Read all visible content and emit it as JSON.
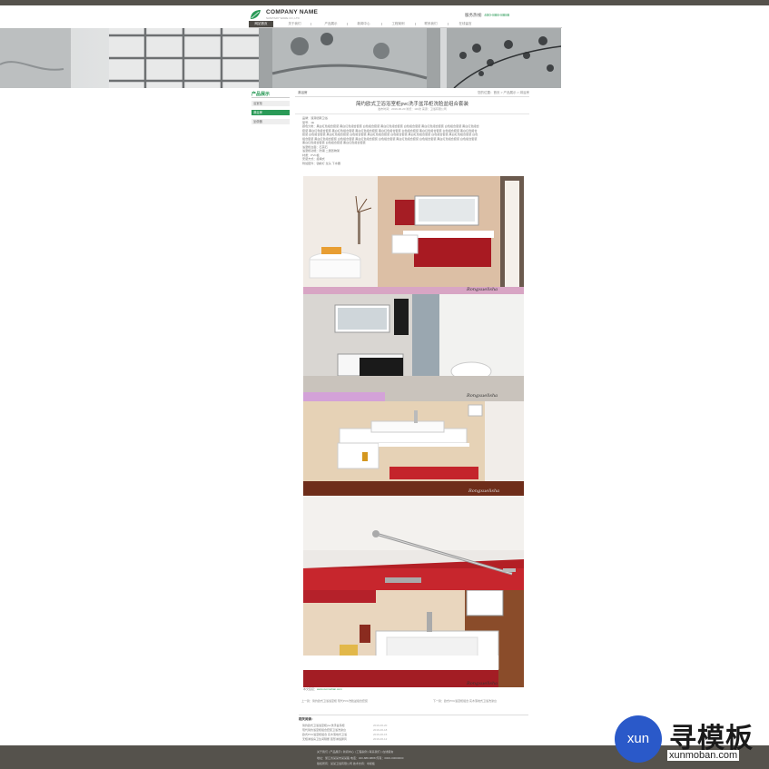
{
  "header": {
    "company_name": "COMPANY NAME",
    "company_sub": "SANITARY WARE CO.,LTD",
    "hotline_label": "服务热线:",
    "hotline_number": "400-888-8888",
    "brand_color": "#2a9a57"
  },
  "nav": {
    "items": [
      "网站首页",
      "关于我们",
      "产品展示",
      "新闻中心",
      "工程案例",
      "联系我们",
      "在线留言"
    ],
    "active_index": 0
  },
  "sidebar": {
    "title": "产品展示",
    "items": [
      "浴室柜",
      "淋浴房",
      "坐便器"
    ],
    "active_index": 1
  },
  "breadcrumb": {
    "title": "淋浴房",
    "path": "您的位置：首页 > 产品展示 > 淋浴房"
  },
  "article": {
    "title": "简约欧式卫浴浴室柜pvc洗手盆吊柜洗脸盆组合套装",
    "meta": "发布时间：2016-06-20    浏览：116次    来源：卫浴有限公司",
    "desc_lines": [
      "品牌：浪潮德斯卫浴",
      "型号：1E",
      "颜色分类：黑白红色组合套装 黑白红色组合套装 白色组合套装 黑白红色组合套装 白色组合套装 黑白红色组合套装 白色组合套装 黑白红色组合",
      "套装 黑白红色组合套装 黑白红色组合套装 黑白红色组合套装 黑白红色组合套装 白色组合套装 黑白红色组合套装 白色组合套装 黑白红色组合",
      "套装 白色组合套装 黑白红色组合套装 白色组合套装 黑白红色组合套装 白色组合套装 黑白红色组合套装 白色组合套装 黑白红色组合套装 白色",
      "组合套装 黑白红色组合套装 白色组合套装 黑白红色组合套装 白色组合套装 黑白红色组合套装 白色组合套装 黑白红色组合套装 白色组合套装",
      "黑白红色组合套装 白色组合套装 黑白红色组合套装",
      "浴室柜台面：石英石",
      "浴室柜功能：防潮 二层置物架",
      "材质：PVC板",
      "安装方式：挂墙式",
      "附加配件：镜前灯 龙头 下水器"
    ],
    "photo_caption_label": "本文链接：",
    "photo_caption_url": "www.xunmoban.com",
    "prev": "上一篇：简约欧式卫浴浴室柜 现代PVC洗脸盆组合套装",
    "next": "下一篇：欧式PVC浴室柜组合 实木落地式卫浴洗漱台"
  },
  "related": {
    "title": "相关阅读：",
    "items": [
      {
        "text": "简约欧式卫浴浴室柜pvc洗手盆吊柜",
        "date": "2016-06-20"
      },
      {
        "text": "现代简约浴室柜组合套装卫浴洗漱台",
        "date": "2016-06-18"
      },
      {
        "text": "欧式PVC浴室柜组合 实木落地式卫浴",
        "date": "2016-06-15"
      },
      {
        "text": "无框淋浴房卫生间隔断 弧形淋浴屏风",
        "date": "2016-06-12"
      }
    ]
  },
  "footer": {
    "nav": "关于我们  |  产品展示  |  新闻中心  |  工程案例  |  联系我们  |  在线留言",
    "line1": "地址：浙江省某某市某某路  电话：400-888-8888  传真：0000-00000000",
    "line2": "版权所有：某某卫浴有限公司  技术支持：寻模板"
  },
  "watermark": {
    "logo_text": "xun",
    "brand_cn": "寻模板",
    "url": "xunmoban.com"
  }
}
